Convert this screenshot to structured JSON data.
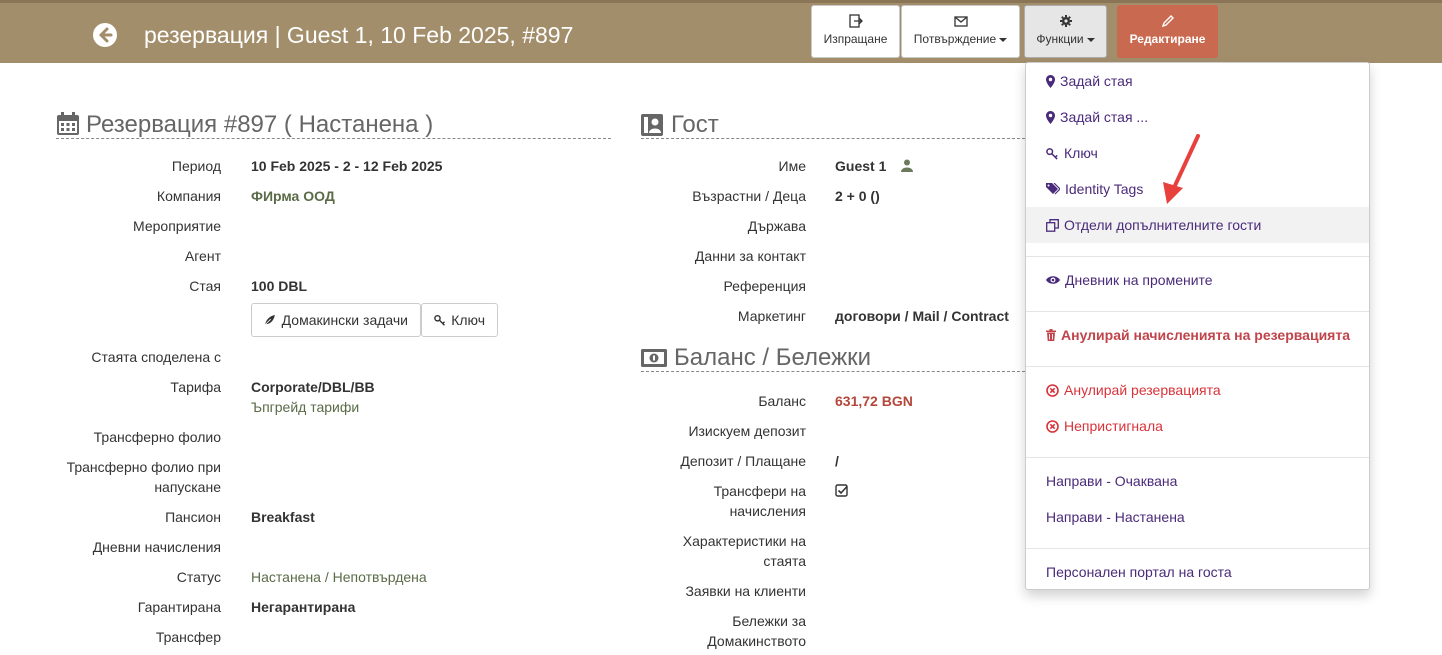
{
  "header": {
    "title": "резервация | Guest 1, 10 Feb 2025, #897",
    "buttons": {
      "send": "Изпращане",
      "confirm": "Потвърждение",
      "functions": "Функции",
      "edit": "Редактиране"
    }
  },
  "reservation": {
    "title": "Резервация #897 ( Настанена )",
    "fields": {
      "period_label": "Период",
      "period": "10 Feb 2025 - 2 - 12 Feb 2025",
      "company_label": "Компания",
      "company": "ФИрма ООД",
      "event_label": "Мероприятие",
      "agent_label": "Агент",
      "room_label": "Стая",
      "room": "100 DBL",
      "housekeeping_btn": "Домакински задачи",
      "key_btn": "Ключ",
      "shared_label": "Стаята споделена с",
      "rate_label": "Тарифа",
      "rate": "Corporate/DBL/BB",
      "upgrade": "Ъпгрейд тарифи",
      "transfer_folio_label": "Трансферно фолио",
      "transfer_folio_checkout_label": "Трансферно фолио при напускане",
      "board_label": "Пансион",
      "board": "Breakfast",
      "daily_label": "Дневни начисления",
      "status_label": "Статус",
      "status": "Настанена / Непотвърдена",
      "guaranteed_label": "Гарантирана",
      "guaranteed": "Негарантирана",
      "transfer_label": "Трансфер"
    }
  },
  "guest": {
    "title": "Гост",
    "fields": {
      "name_label": "Име",
      "name": "Guest 1",
      "ages_label": "Възрастни / Деца",
      "ages": "2 + 0 ()",
      "country_label": "Държава",
      "contact_label": "Данни за контакт",
      "reference_label": "Референция",
      "marketing_label": "Маркетинг",
      "marketing": "договори / Mail / Contract"
    }
  },
  "balance": {
    "title": "Баланс / Бележки",
    "fields": {
      "balance_label": "Баланс",
      "balance": "631,72 BGN",
      "deposit_req_label": "Изискуем депозит",
      "deposit_pay_label": "Депозит / Плащане",
      "deposit_pay": "/",
      "transfers_label": "Трансфери на начисления",
      "room_features_label": "Характеристики на стаята",
      "client_requests_label": "Заявки на клиенти",
      "housekeeping_notes_label": "Бележки за Домакинството"
    }
  },
  "menu": {
    "items": [
      "Задай стая",
      "Задай стая ...",
      "Ключ",
      "Identity Tags",
      "Отдели допълнителните гости",
      "Дневник на промените",
      "Анулирай начисленията на резервацията",
      "Анулирай резервацията",
      "Непристигнала",
      "Направи - Очаквана",
      "Направи - Настанена",
      "Персонален портал на госта"
    ]
  },
  "colors": {
    "header_bg": "#a38e6c",
    "edit_btn": "#c9694f",
    "menu_link": "#4a2a7a",
    "danger": "#d9333a",
    "balance": "#b5473a",
    "arrow": "#e8403d"
  }
}
